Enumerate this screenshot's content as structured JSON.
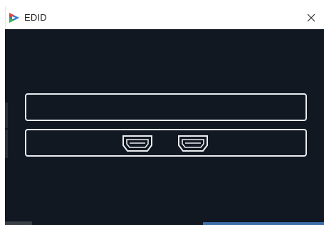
{
  "window": {
    "title": "EDID",
    "icons": {
      "app": "app-logo-icon",
      "close": "close-icon",
      "port": "hdmi-port-icon"
    }
  },
  "ports": [
    {
      "icon": "hdmi-port-icon"
    },
    {
      "icon": "hdmi-port-icon"
    }
  ],
  "colors": {
    "background": "#111822",
    "panel_border": "#e9ecef",
    "titlebar": "#ffffff",
    "logo_red": "#e8413c",
    "logo_blue": "#2e7bd6",
    "logo_green": "#37b24d"
  }
}
